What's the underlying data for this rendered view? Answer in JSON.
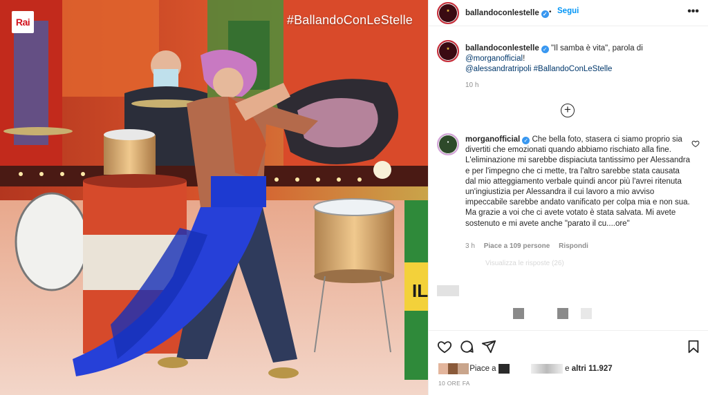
{
  "photo": {
    "channel_logo": "Rai",
    "hashtag_overlay": "#BallandoConLeStelle",
    "description_icon": "dance-photo"
  },
  "header": {
    "username": "ballandoconlestelle",
    "verified": true,
    "separator": "•",
    "follow_label": "Segui",
    "more_icon": "more-horizontal-icon",
    "more_label": "•••"
  },
  "caption": {
    "username": "ballandoconlestelle",
    "text": "\"Il samba è vita\", parola di",
    "mention1": "@morganofficial",
    "text2": "!",
    "mention2": "@alessandratripoli",
    "hashtag": "#BallandoConLeStelle",
    "time": "10 h"
  },
  "load_more_icon": "plus-circle-icon",
  "comment": {
    "username": "morganofficial",
    "verified": true,
    "text": "Che bella foto, stasera ci siamo proprio sia divertiti che emozionati quando abbiamo rischiato alla fine. L'eliminazione mi sarebbe dispiaciuta tantissimo per Alessandra e per l'impegno che ci mette, tra l'altro sarebbe stata causata dal mio atteggiamento verbale quindi ancor più l'avrei ritenuta un'ingiustizia per Alessandra il cui lavoro a mio avviso impeccabile sarebbe andato vanificato per colpa mia e non sua. Ma grazie a voi che ci avete votato è stata salvata. Mi avete sostenuto e mi avete anche \"parato il cu....ore\"",
    "time": "3 h",
    "likes": "Piace a 109 persone",
    "reply": "Rispondi",
    "view_replies": "Visualizza le risposte (26)"
  },
  "actions": {
    "like_icon": "heart-icon",
    "comment_icon": "comment-icon",
    "share_icon": "paper-plane-icon",
    "save_icon": "bookmark-icon"
  },
  "likes": {
    "prefix": "Piace a",
    "connector": "e",
    "others": "altri 11.927"
  },
  "post_time": "10 ORE FA"
}
